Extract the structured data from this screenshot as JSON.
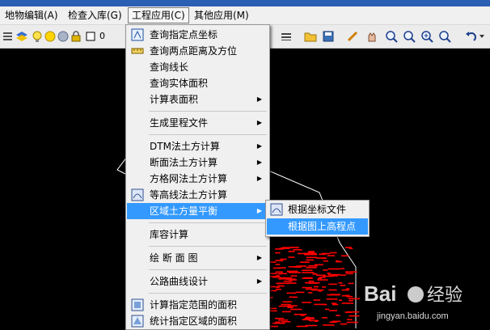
{
  "menubar": {
    "items": [
      {
        "label": "地物编辑(A)"
      },
      {
        "label": "检查入库(G)"
      },
      {
        "label": "工程应用(C)"
      },
      {
        "label": "其他应用(M)"
      }
    ]
  },
  "toolbar": {
    "layer_value": "0"
  },
  "dropdown": {
    "items": [
      {
        "label": "查询指定点坐标"
      },
      {
        "label": "查询两点距离及方位"
      },
      {
        "label": "查询线长"
      },
      {
        "label": "查询实体面积"
      },
      {
        "label": "计算表面积"
      },
      {
        "label": "生成里程文件"
      },
      {
        "label": "DTM法土方计算"
      },
      {
        "label": "断面法土方计算"
      },
      {
        "label": "方格网法土方计算"
      },
      {
        "label": "等高线法土方计算"
      },
      {
        "label": "区域土方量平衡"
      },
      {
        "label": "库容计算"
      },
      {
        "label": "绘 断 面 图"
      },
      {
        "label": "公路曲线设计"
      },
      {
        "label": "计算指定范围的面积"
      },
      {
        "label": "统计指定区域的面积"
      }
    ]
  },
  "submenu": {
    "items": [
      {
        "label": "根据坐标文件"
      },
      {
        "label": "根据图上高程点"
      }
    ]
  },
  "watermark": {
    "brand": "Bai",
    "brand2": "经验",
    "url": "jingyan.baidu.com"
  },
  "colors": {
    "highlight": "#3399ff",
    "menu_bg": "#f0f0f0",
    "canvas": "#000000",
    "points": "#ff0000"
  }
}
